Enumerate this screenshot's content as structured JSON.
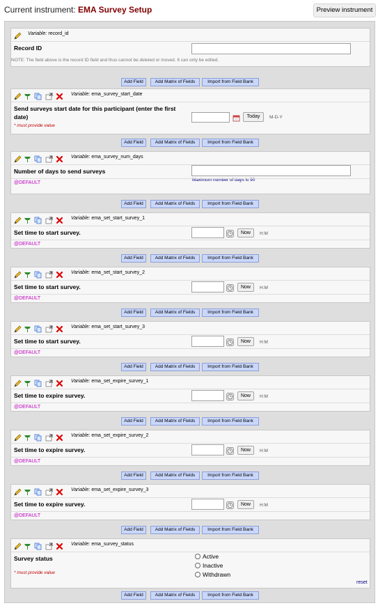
{
  "header": {
    "current_label": "Current instrument:",
    "instrument_name": "EMA Survey Setup",
    "preview_button": "Preview instrument"
  },
  "add_buttons": {
    "add_field": "Add Field",
    "add_matrix": "Add Matrix of Fields",
    "import_bank": "Import from Field Bank"
  },
  "variable_prefix": "Variable:",
  "record_field": {
    "variable": "record_id",
    "label": "Record ID",
    "note": "NOTE: The field above is the record ID field and thus cannot be deleted or moved. It can only be edited."
  },
  "fields": [
    {
      "variable": "ema_survey_start_date",
      "label": "Send surveys start date for this participant (enter the first date)",
      "required": "* must provide value",
      "today_button": "Today",
      "format": "M-D-Y"
    },
    {
      "variable": "ema_survey_num_days",
      "label": "Number of days to send surveys",
      "max_note": "Maximum number of days is 90",
      "default_tag": "@DEFAULT"
    },
    {
      "variable": "ema_set_start_survey_1",
      "label": "Set time to start survey.",
      "now_button": "Now",
      "format": "H:M",
      "default_tag": "@DEFAULT"
    },
    {
      "variable": "ema_set_start_survey_2",
      "label": "Set time to start survey.",
      "now_button": "Now",
      "format": "H:M",
      "default_tag": "@DEFAULT"
    },
    {
      "variable": "ema_set_start_survey_3",
      "label": "Set time to start survey.",
      "now_button": "Now",
      "format": "H:M",
      "default_tag": "@DEFAULT"
    },
    {
      "variable": "ema_set_expire_survey_1",
      "label": "Set time to expire survey.",
      "now_button": "Now",
      "format": "H:M",
      "default_tag": "@DEFAULT"
    },
    {
      "variable": "ema_set_expire_survey_2",
      "label": "Set time to expire survey.",
      "now_button": "Now",
      "format": "H:M",
      "default_tag": "@DEFAULT"
    },
    {
      "variable": "ema_set_expire_survey_3",
      "label": "Set time to expire survey.",
      "now_button": "Now",
      "format": "H:M",
      "default_tag": "@DEFAULT"
    },
    {
      "variable": "ema_survey_status",
      "label": "Survey status",
      "required": "* must provide value",
      "options": [
        "Active",
        "Inactive",
        "Withdrawn"
      ],
      "reset": "reset"
    }
  ],
  "colors": {
    "instrument_name": "#800000",
    "required": "#c00000",
    "default_tag": "#c000c0",
    "add_button_bg": "#c9d7fb"
  }
}
